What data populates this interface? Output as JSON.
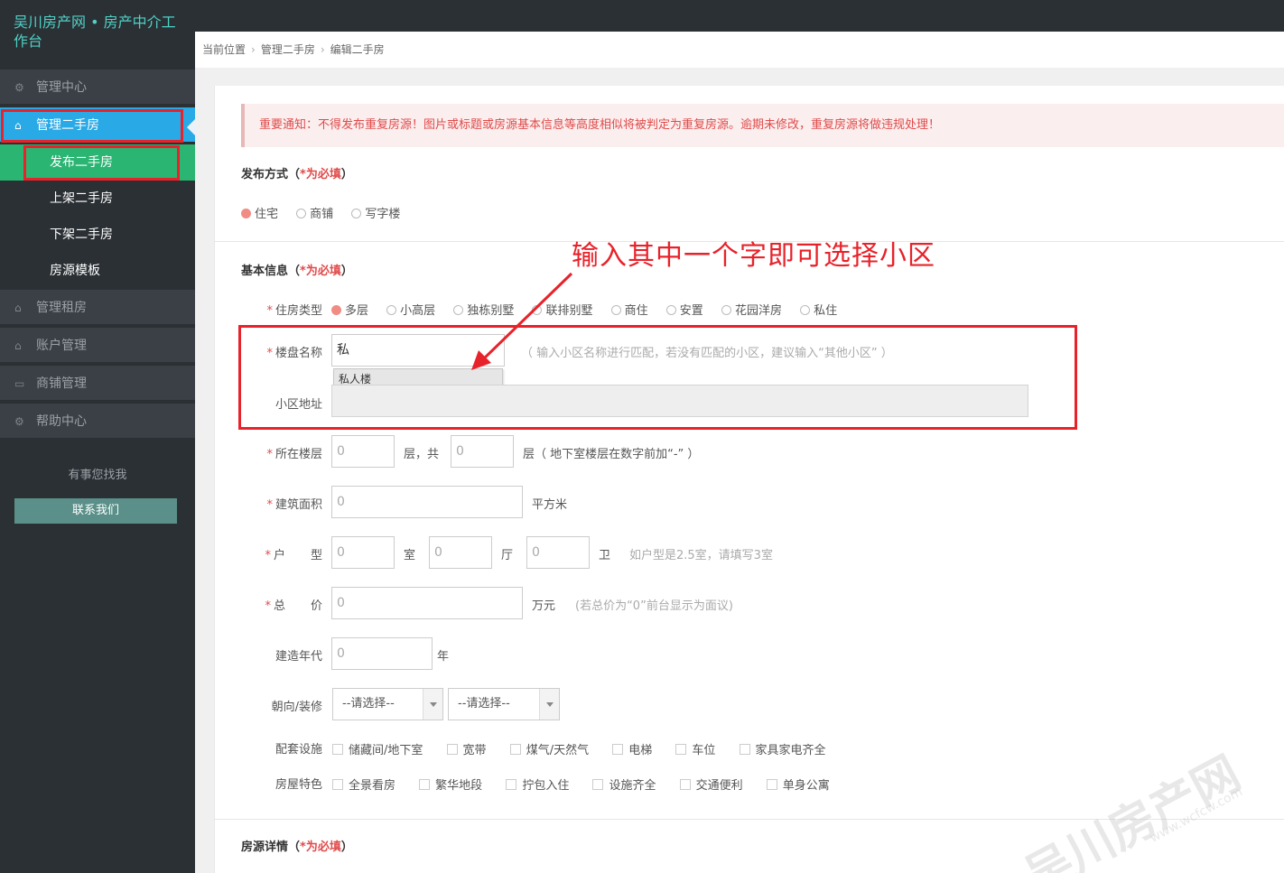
{
  "sidebar": {
    "brand": "吴川房产网 • 房产中介工作台",
    "nav": [
      {
        "label": "管理中心",
        "icon": "gear-icon"
      },
      {
        "label": "管理二手房",
        "icon": "home-icon"
      },
      {
        "label": "管理租房",
        "icon": "home-icon"
      },
      {
        "label": "账户管理",
        "icon": "home-icon"
      },
      {
        "label": "商铺管理",
        "icon": "card-icon"
      },
      {
        "label": "帮助中心",
        "icon": "gear-icon"
      }
    ],
    "subnav": [
      "发布二手房",
      "上架二手房",
      "下架二手房",
      "房源模板"
    ],
    "help_text": "有事您找我",
    "contact_label": "联系我们"
  },
  "breadcrumb": [
    "当前位置",
    "管理二手房",
    "编辑二手房"
  ],
  "notice": "重要通知：不得发布重复房源！图片或标题或房源基本信息等高度相似将被判定为重复房源。逾期未修改，重复房源将做违规处理！",
  "publish": {
    "title": "发布方式（",
    "req": "*为必填",
    "close": "）",
    "options": [
      "住宅",
      "商铺",
      "写字楼"
    ],
    "selected": 0
  },
  "basic": {
    "title": "基本信息（",
    "req": "*为必填",
    "close": "）",
    "type_label": "住房类型",
    "types": [
      "多层",
      "小高层",
      "独栋别墅",
      "联排别墅",
      "商住",
      "安置",
      "花园洋房",
      "私住"
    ],
    "type_selected": 0,
    "estate_label": "楼盘名称",
    "estate_value": "私",
    "estate_hint": "（ 输入小区名称进行匹配，若没有匹配的小区，建议输入“其他小区” ）",
    "suggestion": "私人楼",
    "address_label": "小区地址",
    "floor_label": "所在楼层",
    "floor_value": "0",
    "floor_mid": "层，共",
    "floor_total": "0",
    "floor_hint": "层（ 地下室楼层在数字前加“-” ）",
    "area_label": "建筑面积",
    "area_value": "0",
    "area_unit": "平方米",
    "layout_label_a": "户",
    "layout_label_b": "型",
    "rooms": "0",
    "room_unit": "室",
    "halls": "0",
    "hall_unit": "厅",
    "baths": "0",
    "bath_unit": "卫",
    "layout_hint": "如户型是2.5室，请填写3室",
    "price_label_a": "总",
    "price_label_b": "价",
    "price_value": "0",
    "price_unit": "万元",
    "price_hint": "(若总价为“0”前台显示为面议)",
    "year_label": "建造年代",
    "year_value": "0",
    "year_unit": "年",
    "orient_label": "朝向/装修",
    "orient_select": "--请选择--",
    "decor_select": "--请选择--",
    "facility_label": "配套设施",
    "facilities": [
      "储藏间/地下室",
      "宽带",
      "煤气/天然气",
      "电梯",
      "车位",
      "家具家电齐全"
    ],
    "feature_label": "房屋特色",
    "features": [
      "全景看房",
      "繁华地段",
      "拧包入住",
      "设施齐全",
      "交通便利",
      "单身公寓"
    ]
  },
  "details": {
    "title": "房源详情（",
    "req": "*为必填",
    "close": "）"
  },
  "annotation": "输入其中一个字即可选择小区",
  "watermark": "吴川房产网",
  "watermark_url": "www.wcfcw.com",
  "colors": {
    "accent_blue": "#29a9e6",
    "accent_green": "#2bb573",
    "annotation_red": "#e8222a"
  }
}
